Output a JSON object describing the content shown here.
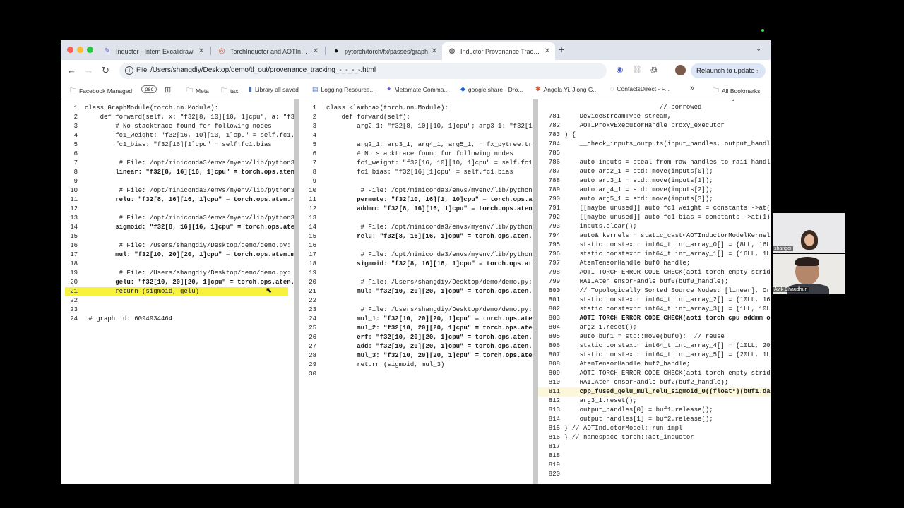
{
  "tabs": [
    {
      "label": "Inductor - Intern Excalidraw",
      "icon": "excalidraw-icon",
      "active": false
    },
    {
      "label": "TorchInductor and AOTInductor",
      "icon": "pytorch-icon",
      "active": false
    },
    {
      "label": "pytorch/torch/fx/passes/graph",
      "icon": "github-icon",
      "active": false
    },
    {
      "label": "Inductor Provenance Tracking",
      "icon": "globe-icon",
      "active": true
    }
  ],
  "address": {
    "scheme_label": "File",
    "url": "/Users/shangdiy/Desktop/demo/tl_out/provenance_tracking_-_-_-_-.html"
  },
  "relaunch_label": "Relaunch to update",
  "bookmarks": [
    {
      "label": "Facebook Managed",
      "icon": "folder-icon"
    },
    {
      "label": "psc",
      "icon": "",
      "badge": true
    },
    {
      "label": "",
      "icon": "apps-grid-icon"
    },
    {
      "label": "Meta",
      "icon": "folder-icon"
    },
    {
      "label": "tax",
      "icon": "folder-icon"
    },
    {
      "label": "Library all saved",
      "icon": "bookmark-icon"
    },
    {
      "label": "Logging Resource...",
      "icon": "doc-icon"
    },
    {
      "label": "Metamate Comma...",
      "icon": "metamate-icon"
    },
    {
      "label": "google share - Dro...",
      "icon": "dropbox-icon"
    },
    {
      "label": "Angela Yi, Jiong G...",
      "icon": "chat-icon"
    },
    {
      "label": "ContactsDirect - F...",
      "icon": "circle-icon"
    },
    {
      "label": "»",
      "icon": ""
    },
    {
      "label": "All Bookmarks",
      "icon": "folder-icon"
    }
  ],
  "panes": [
    {
      "name": "pre-grad-graph",
      "lines": [
        {
          "n": "1",
          "t": "class GraphModule(torch.nn.Module):"
        },
        {
          "n": "2",
          "t": "    def forward(self, x: \"f32[8, 10][10, 1]cpu\", a: \"f32"
        },
        {
          "n": "3",
          "t": "        # No stacktrace found for following nodes"
        },
        {
          "n": "4",
          "t": "        fc1_weight: \"f32[16, 10][10, 1]cpu\" = self.fc1."
        },
        {
          "n": "5",
          "t": "        fc1_bias: \"f32[16][1]cpu\" = self.fc1.bias"
        },
        {
          "n": "6",
          "t": ""
        },
        {
          "n": "7",
          "t": "         # File: /opt/miniconda3/envs/myenv/lib/python3"
        },
        {
          "n": "8",
          "t": "        linear: \"f32[8, 16][16, 1]cpu\" = torch.ops.aten",
          "b": true
        },
        {
          "n": "9",
          "t": ""
        },
        {
          "n": "10",
          "t": "         # File: /opt/miniconda3/envs/myenv/lib/python3"
        },
        {
          "n": "11",
          "t": "        relu: \"f32[8, 16][16, 1]cpu\" = torch.ops.aten.r",
          "b": true
        },
        {
          "n": "12",
          "t": ""
        },
        {
          "n": "13",
          "t": "         # File: /opt/miniconda3/envs/myenv/lib/python3"
        },
        {
          "n": "14",
          "t": "        sigmoid: \"f32[8, 16][16, 1]cpu\" = torch.ops.ate",
          "b": true
        },
        {
          "n": "15",
          "t": ""
        },
        {
          "n": "16",
          "t": "         # File: /Users/shangdiy/Desktop/demo/demo.py:"
        },
        {
          "n": "17",
          "t": "        mul: \"f32[10, 20][20, 1]cpu\" = torch.ops.aten.m",
          "b": true
        },
        {
          "n": "18",
          "t": ""
        },
        {
          "n": "19",
          "t": "         # File: /Users/shangdiy/Desktop/demo/demo.py:"
        },
        {
          "n": "20",
          "t": "        gelu: \"f32[10, 20][20, 1]cpu\" = torch.ops.aten.",
          "b": true
        },
        {
          "n": "21",
          "t": "        return (sigmoid, gelu)",
          "hl": true
        },
        {
          "n": "22",
          "t": ""
        },
        {
          "n": "23",
          "t": ""
        },
        {
          "n": "24",
          "t": " # graph id: 6094934464"
        }
      ]
    },
    {
      "name": "post-grad-graph",
      "lines": [
        {
          "n": "1",
          "t": "class <lambda>(torch.nn.Module):"
        },
        {
          "n": "2",
          "t": "    def forward(self):"
        },
        {
          "n": "3",
          "t": "        arg2_1: \"f32[8, 10][10, 1]cpu\"; arg3_1: \"f32[10"
        },
        {
          "n": "4",
          "t": ""
        },
        {
          "n": "5",
          "t": "        arg2_1, arg3_1, arg4_1, arg5_1, = fx_pytree.tre"
        },
        {
          "n": "6",
          "t": "        # No stacktrace found for following nodes"
        },
        {
          "n": "7",
          "t": "        fc1_weight: \"f32[16, 10][10, 1]cpu\" = self.fc1."
        },
        {
          "n": "8",
          "t": "        fc1_bias: \"f32[16][1]cpu\" = self.fc1.bias"
        },
        {
          "n": "9",
          "t": ""
        },
        {
          "n": "10",
          "t": "         # File: /opt/miniconda3/envs/myenv/lib/python3"
        },
        {
          "n": "11",
          "t": "        permute: \"f32[10, 16][1, 10]cpu\" = torch.ops.at",
          "b": true
        },
        {
          "n": "12",
          "t": "        addmm: \"f32[8, 16][16, 1]cpu\" = torch.ops.aten.",
          "b": true
        },
        {
          "n": "13",
          "t": ""
        },
        {
          "n": "14",
          "t": "         # File: /opt/miniconda3/envs/myenv/lib/python3"
        },
        {
          "n": "15",
          "t": "        relu: \"f32[8, 16][16, 1]cpu\" = torch.ops.aten.r",
          "b": true
        },
        {
          "n": "16",
          "t": ""
        },
        {
          "n": "17",
          "t": "         # File: /opt/miniconda3/envs/myenv/lib/python3"
        },
        {
          "n": "18",
          "t": "        sigmoid: \"f32[8, 16][16, 1]cpu\" = torch.ops.ate",
          "b": true
        },
        {
          "n": "19",
          "t": ""
        },
        {
          "n": "20",
          "t": "         # File: /Users/shangdiy/Desktop/demo/demo.py:"
        },
        {
          "n": "21",
          "t": "        mul: \"f32[10, 20][20, 1]cpu\" = torch.ops.aten.m",
          "b": true
        },
        {
          "n": "22",
          "t": ""
        },
        {
          "n": "23",
          "t": "         # File: /Users/shangdiy/Desktop/demo/demo.py:"
        },
        {
          "n": "24",
          "t": "        mul_1: \"f32[10, 20][20, 1]cpu\" = torch.ops.aten",
          "b": true
        },
        {
          "n": "25",
          "t": "        mul_2: \"f32[10, 20][20, 1]cpu\" = torch.ops.aten",
          "b": true
        },
        {
          "n": "26",
          "t": "        erf: \"f32[10, 20][20, 1]cpu\" = torch.ops.aten.e",
          "b": true
        },
        {
          "n": "27",
          "t": "        add: \"f32[10, 20][20, 1]cpu\" = torch.ops.aten.a",
          "b": true
        },
        {
          "n": "28",
          "t": "        mul_3: \"f32[10, 20][20, 1]cpu\" = torch.ops.aten",
          "b": true
        },
        {
          "n": "29",
          "t": "        return (sigmoid, mul_3)"
        },
        {
          "n": "30",
          "t": ""
        }
      ]
    },
    {
      "name": "cpp-code",
      "lines": [
        {
          "n": "",
          "t": "                         // will be stolen by the calle"
        },
        {
          "n": "",
          "t": "                         // borrowed"
        },
        {
          "n": "781",
          "t": "    DeviceStreamType stream,"
        },
        {
          "n": "782",
          "t": "    AOTIProxyExecutorHandle proxy_executor"
        },
        {
          "n": "783",
          "t": ") {"
        },
        {
          "n": "784",
          "t": "    __check_inputs_outputs(input_handles, output_handle"
        },
        {
          "n": "785",
          "t": ""
        },
        {
          "n": "786",
          "t": "    auto inputs = steal_from_raw_handles_to_raii_handle"
        },
        {
          "n": "787",
          "t": "    auto arg2_1 = std::move(inputs[0]);"
        },
        {
          "n": "788",
          "t": "    auto arg3_1 = std::move(inputs[1]);"
        },
        {
          "n": "789",
          "t": "    auto arg4_1 = std::move(inputs[2]);"
        },
        {
          "n": "790",
          "t": "    auto arg5_1 = std::move(inputs[3]);"
        },
        {
          "n": "791",
          "t": "    [[maybe_unused]] auto fc1_weight = constants_->at(0"
        },
        {
          "n": "792",
          "t": "    [[maybe_unused]] auto fc1_bias = constants_->at(1);"
        },
        {
          "n": "793",
          "t": "    inputs.clear();"
        },
        {
          "n": "794",
          "t": "    auto& kernels = static_cast<AOTInductorModelKernels"
        },
        {
          "n": "795",
          "t": "    static constexpr int64_t int_array_0[] = {8LL, 16LL"
        },
        {
          "n": "796",
          "t": "    static constexpr int64_t int_array_1[] = {16LL, 1LL"
        },
        {
          "n": "797",
          "t": "    AtenTensorHandle buf0_handle;"
        },
        {
          "n": "798",
          "t": "    AOTI_TORCH_ERROR_CODE_CHECK(aoti_torch_empty_stride"
        },
        {
          "n": "799",
          "t": "    RAIIAtenTensorHandle buf0(buf0_handle);"
        },
        {
          "n": "800",
          "t": "    // Topologically Sorted Source Nodes: [linear], Ori"
        },
        {
          "n": "801",
          "t": "    static constexpr int64_t int_array_2[] = {10LL, 16L"
        },
        {
          "n": "802",
          "t": "    static constexpr int64_t int_array_3[] = {1LL, 10LL"
        },
        {
          "n": "803",
          "t": "    AOTI_TORCH_ERROR_CODE_CHECK(aoti_torch_cpu_addmm_ou",
          "b": true
        },
        {
          "n": "804",
          "t": "    arg2_1.reset();"
        },
        {
          "n": "805",
          "t": "    auto buf1 = std::move(buf0);  // reuse"
        },
        {
          "n": "806",
          "t": "    static constexpr int64_t int_array_4[] = {10LL, 20L"
        },
        {
          "n": "807",
          "t": "    static constexpr int64_t int_array_5[] = {20LL, 1LL"
        },
        {
          "n": "808",
          "t": "    AtenTensorHandle buf2_handle;"
        },
        {
          "n": "809",
          "t": "    AOTI_TORCH_ERROR_CODE_CHECK(aoti_torch_empty_stride"
        },
        {
          "n": "810",
          "t": "    RAIIAtenTensorHandle buf2(buf2_handle);"
        },
        {
          "n": "811",
          "t": "    cpp_fused_gelu_mul_relu_sigmoid_0((float*)(buf1.dat",
          "b": true,
          "hl": true
        },
        {
          "n": "812",
          "t": "    arg3_1.reset();"
        },
        {
          "n": "813",
          "t": "    output_handles[0] = buf1.release();"
        },
        {
          "n": "814",
          "t": "    output_handles[1] = buf2.release();"
        },
        {
          "n": "815",
          "t": "} // AOTInductorModel::run_impl"
        },
        {
          "n": "816",
          "t": "} // namespace torch::aot_inductor"
        },
        {
          "n": "817",
          "t": ""
        },
        {
          "n": "818",
          "t": ""
        },
        {
          "n": "819",
          "t": ""
        },
        {
          "n": "820",
          "t": ""
        }
      ]
    }
  ],
  "participants": [
    {
      "name": "shangdi"
    },
    {
      "name": "Avik Chaudhuri"
    }
  ],
  "colors": {
    "highlight_yellow": "#f7f23c",
    "highlight_cream": "#fbf7d8"
  }
}
